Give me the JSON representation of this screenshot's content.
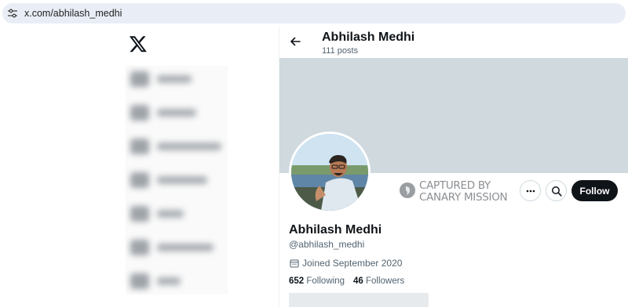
{
  "browser": {
    "url": "x.com/abhilash_medhi",
    "site_info_icon": "tune-icon"
  },
  "nav": {
    "logo_icon": "x-logo-icon",
    "blurred_item_count": 7
  },
  "header": {
    "back_icon": "arrow-left-icon",
    "title": "Abhilash Medhi",
    "post_count": "111 posts"
  },
  "watermark": {
    "line1": "CAPTURED BY",
    "line2": "CANARY MISSION"
  },
  "actions": {
    "more_icon": "more-horizontal-icon",
    "search_icon": "search-icon",
    "follow_label": "Follow"
  },
  "profile": {
    "display_name": "Abhilash Medhi",
    "handle": "@abhilash_medhi",
    "joined": "Joined September 2020",
    "following_count": "652",
    "following_label": "Following",
    "followers_count": "46",
    "followers_label": "Followers"
  },
  "colors": {
    "banner": "#cfd9de",
    "follow_button": "#0f1419",
    "secondary_text": "#536471"
  }
}
